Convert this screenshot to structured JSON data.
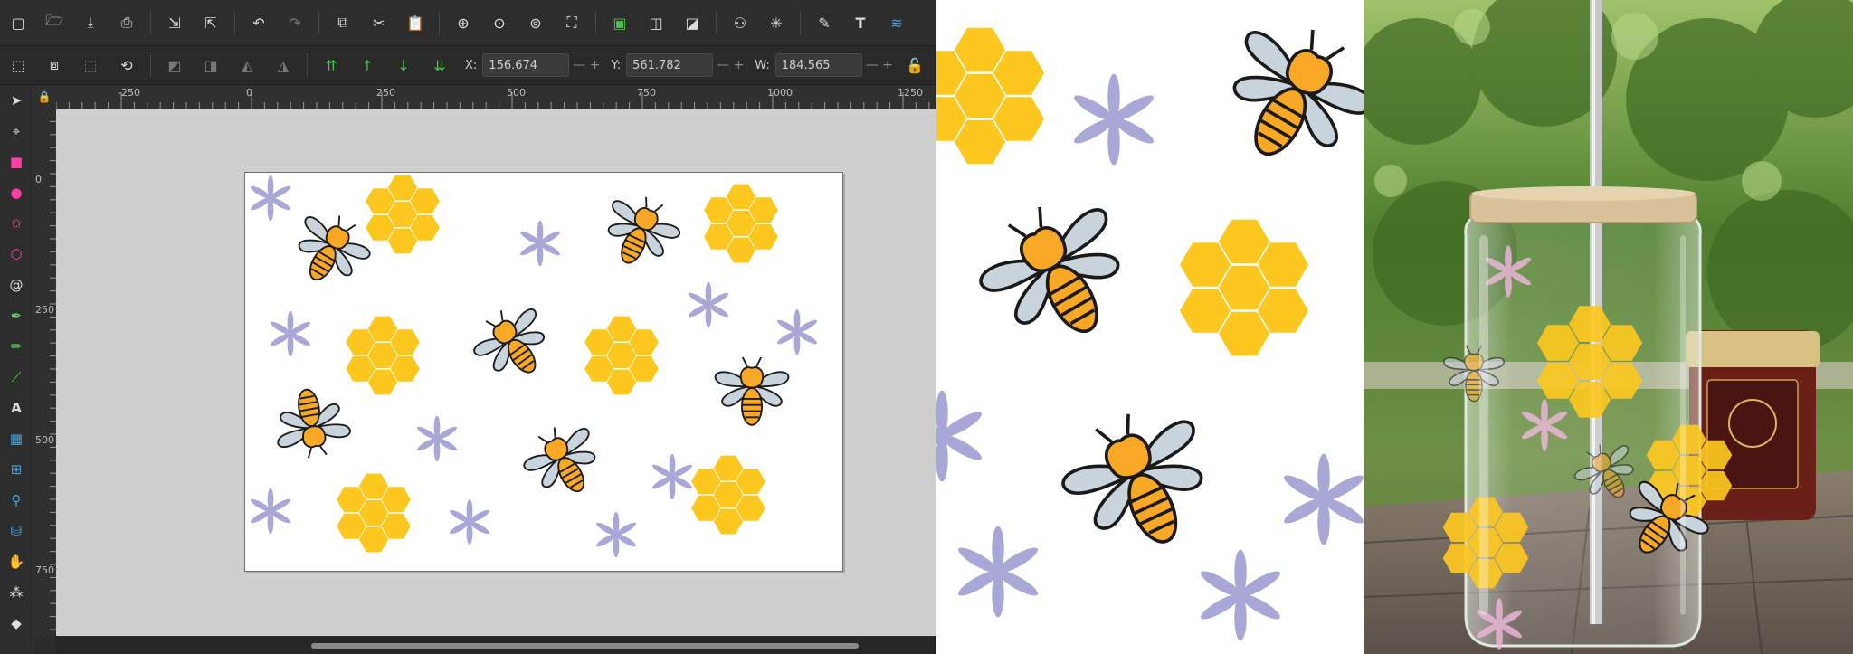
{
  "app": {
    "toolbar_top": {
      "buttons": [
        "new",
        "open",
        "save",
        "print",
        "import",
        "export",
        "undo",
        "redo",
        "duplicate",
        "cut",
        "paste",
        "zoom-selection",
        "zoom-drawing",
        "zoom-page",
        "zoom-fit",
        "group",
        "ungroup",
        "raise",
        "lower",
        "align",
        "xml-editor",
        "text-tool-button"
      ]
    },
    "toolbar_coords": {
      "x_label": "X:",
      "x_value": "156.674",
      "y_label": "Y:",
      "y_value": "561.782",
      "w_label": "W:",
      "w_value": "184.565"
    },
    "ruler_h_labels": [
      "-250",
      "0",
      "250",
      "500",
      "750",
      "1000",
      "1250"
    ],
    "ruler_v_labels": [
      "0",
      "250",
      "500",
      "750"
    ]
  },
  "colors": {
    "honey": "#fcc820",
    "bee_body": "#f8a824",
    "wing": "#c9d3dc",
    "flower": "#a9a7d6"
  }
}
